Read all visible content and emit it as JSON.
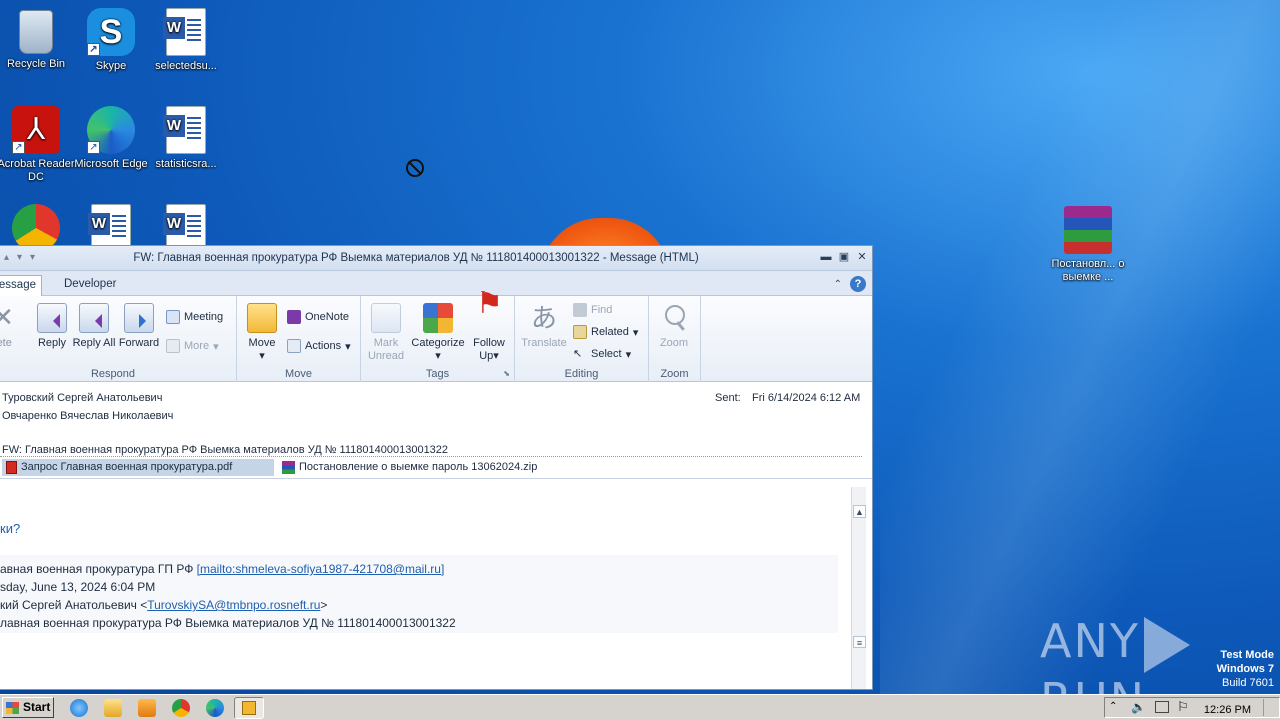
{
  "desktop": {
    "icons": [
      {
        "label": "Recycle Bin",
        "icon": "recycle-bin-icon"
      },
      {
        "label": "Skype",
        "icon": "skype-icon"
      },
      {
        "label": "selectedsu...",
        "icon": "word-document-icon"
      },
      {
        "label": "Acrobat Reader DC",
        "icon": "acrobat-reader-icon"
      },
      {
        "label": "Microsoft Edge",
        "icon": "edge-icon"
      },
      {
        "label": "statisticsra...",
        "icon": "word-document-icon"
      },
      {
        "label": "Постановл... о выемке ...",
        "icon": "winrar-archive-icon"
      }
    ]
  },
  "window": {
    "title": "FW: Главная военная прокуратура РФ Выемка материалов УД № 111801400013001322  - Message (HTML)",
    "tabs": {
      "message": "essage",
      "developer": "Developer"
    },
    "ribbon": {
      "delete": "lete",
      "reply": "Reply",
      "reply_all": "Reply All",
      "forward": "Forward",
      "meeting": "Meeting",
      "more": "More",
      "respond_label": "Respond",
      "move": "Move",
      "onenote": "OneNote",
      "actions": "Actions",
      "move_label": "Move",
      "mark_unread": "Mark Unread",
      "categorize": "Categorize",
      "follow_up": "Follow Up",
      "tags_label": "Tags",
      "translate": "Translate",
      "find": "Find",
      "related": "Related",
      "select": "Select",
      "editing_label": "Editing",
      "zoom": "Zoom",
      "zoom_label": "Zoom"
    },
    "header": {
      "from": "Туровский Сергей Анатольевич",
      "to": "Овчаренко Вячеслав Николаевич",
      "sent_label": "Sent:",
      "sent_value": "Fri 6/14/2024 6:12 AM",
      "subject": "FW: Главная военная прокуратура РФ Выемка материалов УД № 111801400013001322"
    },
    "attachments": [
      {
        "name": "Запрос Главная военная прокуратура.pdf"
      },
      {
        "name": "Постановление о выемке  пароль 13062024.zip"
      }
    ],
    "body": {
      "line1": "ки?",
      "from_prefix": "авная военная прокуратура ГП РФ ",
      "from_mailto": "[mailto:shmeleva-sofiya1987-421708@mail.ru]",
      "sent_line": "sday, June 13, 2024 6:04 PM",
      "to_prefix": "кий Сергей Анатольевич <",
      "to_email": "TurovskiySA@tmbnpo.rosneft.ru",
      "to_suffix": ">",
      "subject_line": "лавная военная прокуратура РФ Выемка материалов УД № 111801400013001322"
    }
  },
  "watermark": {
    "brand_left": "ANY",
    "brand_right": "RUN",
    "test_mode": "Test Mode",
    "os": "Windows 7",
    "build": "Build 7601"
  },
  "taskbar": {
    "start": "Start",
    "clock": "12:26 PM"
  }
}
